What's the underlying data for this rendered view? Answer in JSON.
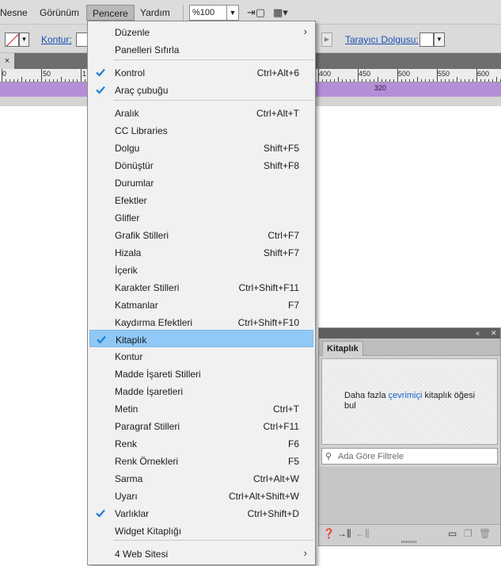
{
  "menubar": {
    "items": [
      {
        "label": "Nesne",
        "active": false
      },
      {
        "label": "Görünüm",
        "active": false
      },
      {
        "label": "Pencere",
        "active": true
      },
      {
        "label": "Yardım",
        "active": false
      }
    ],
    "zoom_value": "%100",
    "icons": [
      "new-page-icon",
      "screen-mode-icon"
    ]
  },
  "controlbar": {
    "kontur_label": "Kontur:",
    "tarayici_label": "Tarayıcı Dolgusu:"
  },
  "document": {
    "close_glyph": "×",
    "ruler_labels": [
      "0",
      "50",
      "1",
      "400",
      "450",
      "500",
      "550",
      "600"
    ],
    "purple_label": "320"
  },
  "pencere_menu": {
    "items": [
      {
        "label": "Düzenle",
        "shortcut": "",
        "checked": false,
        "submenu": true,
        "highlighted": false
      },
      {
        "label": "Panelleri Sıfırla",
        "shortcut": "",
        "checked": false,
        "submenu": false,
        "highlighted": false
      },
      {
        "label": "Kontrol",
        "shortcut": "Ctrl+Alt+6",
        "checked": true,
        "submenu": false,
        "highlighted": false
      },
      {
        "label": "Araç çubuğu",
        "shortcut": "",
        "checked": true,
        "submenu": false,
        "highlighted": false
      },
      {
        "label": "Aralık",
        "shortcut": "Ctrl+Alt+T",
        "checked": false,
        "submenu": false,
        "highlighted": false
      },
      {
        "label": "CC Libraries",
        "shortcut": "",
        "checked": false,
        "submenu": false,
        "highlighted": false
      },
      {
        "label": "Dolgu",
        "shortcut": "Shift+F5",
        "checked": false,
        "submenu": false,
        "highlighted": false
      },
      {
        "label": "Dönüştür",
        "shortcut": "Shift+F8",
        "checked": false,
        "submenu": false,
        "highlighted": false
      },
      {
        "label": "Durumlar",
        "shortcut": "",
        "checked": false,
        "submenu": false,
        "highlighted": false
      },
      {
        "label": "Efektler",
        "shortcut": "",
        "checked": false,
        "submenu": false,
        "highlighted": false
      },
      {
        "label": "Glifler",
        "shortcut": "",
        "checked": false,
        "submenu": false,
        "highlighted": false
      },
      {
        "label": "Grafik Stilleri",
        "shortcut": "Ctrl+F7",
        "checked": false,
        "submenu": false,
        "highlighted": false
      },
      {
        "label": "Hizala",
        "shortcut": "Shift+F7",
        "checked": false,
        "submenu": false,
        "highlighted": false
      },
      {
        "label": "İçerik",
        "shortcut": "",
        "checked": false,
        "submenu": false,
        "highlighted": false
      },
      {
        "label": "Karakter Stilleri",
        "shortcut": "Ctrl+Shift+F11",
        "checked": false,
        "submenu": false,
        "highlighted": false
      },
      {
        "label": "Katmanlar",
        "shortcut": "F7",
        "checked": false,
        "submenu": false,
        "highlighted": false
      },
      {
        "label": "Kaydırma Efektleri",
        "shortcut": "Ctrl+Shift+F10",
        "checked": false,
        "submenu": false,
        "highlighted": false
      },
      {
        "label": "Kitaplık",
        "shortcut": "",
        "checked": true,
        "submenu": false,
        "highlighted": true
      },
      {
        "label": "Kontur",
        "shortcut": "",
        "checked": false,
        "submenu": false,
        "highlighted": false
      },
      {
        "label": "Madde İşareti Stilleri",
        "shortcut": "",
        "checked": false,
        "submenu": false,
        "highlighted": false
      },
      {
        "label": "Madde İşaretleri",
        "shortcut": "",
        "checked": false,
        "submenu": false,
        "highlighted": false
      },
      {
        "label": "Metin",
        "shortcut": "Ctrl+T",
        "checked": false,
        "submenu": false,
        "highlighted": false
      },
      {
        "label": "Paragraf Stilleri",
        "shortcut": "Ctrl+F11",
        "checked": false,
        "submenu": false,
        "highlighted": false
      },
      {
        "label": "Renk",
        "shortcut": "F6",
        "checked": false,
        "submenu": false,
        "highlighted": false
      },
      {
        "label": "Renk Örnekleri",
        "shortcut": "F5",
        "checked": false,
        "submenu": false,
        "highlighted": false
      },
      {
        "label": "Sarma",
        "shortcut": "Ctrl+Alt+W",
        "checked": false,
        "submenu": false,
        "highlighted": false
      },
      {
        "label": "Uyarı",
        "shortcut": "Ctrl+Alt+Shift+W",
        "checked": false,
        "submenu": false,
        "highlighted": false
      },
      {
        "label": "Varlıklar",
        "shortcut": "Ctrl+Shift+D",
        "checked": true,
        "submenu": false,
        "highlighted": false
      },
      {
        "label": "Widget Kitaplığı",
        "shortcut": "",
        "checked": false,
        "submenu": false,
        "highlighted": false
      },
      {
        "label": "4 Web Sitesi",
        "shortcut": "",
        "checked": false,
        "submenu": true,
        "highlighted": false
      }
    ],
    "check_color": "#1e7fd6",
    "highlight_color": "#90c8f6"
  },
  "library_panel": {
    "tab_label": "Kitaplık",
    "message_before": "Daha fazla ",
    "message_link": "çevrimiçi",
    "message_after": " kitaplık öğesi bul",
    "search_placeholder": "Ada Göre Filtrele",
    "footer_icons": [
      "help-icon",
      "import-icon",
      "export-icon",
      "folder-icon",
      "new-item-icon",
      "trash-icon"
    ]
  }
}
